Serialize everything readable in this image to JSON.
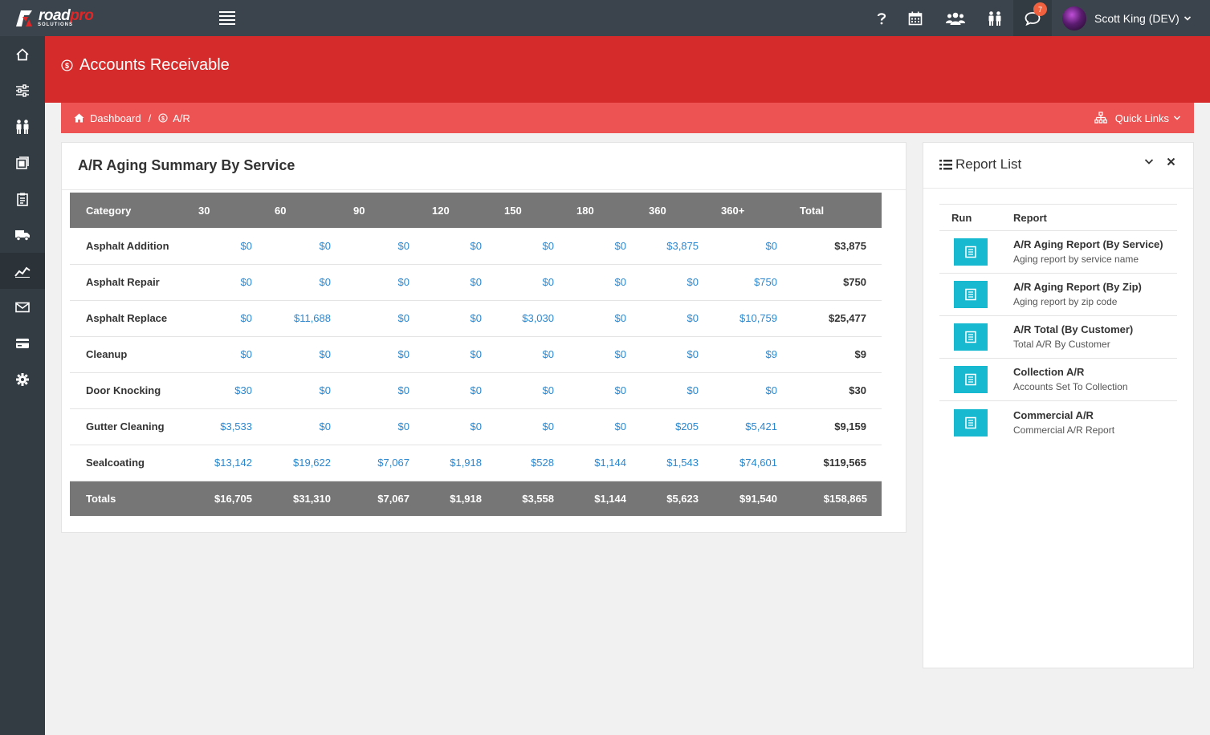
{
  "brand": {
    "part1": "road",
    "part2": "pro",
    "sub": "SOLUTIONS"
  },
  "topbar": {
    "icons": [
      "help-icon",
      "calendar-icon",
      "users-group-icon",
      "people-icon",
      "chat-icon"
    ],
    "chat_badge": "7",
    "user_name": "Scott King (DEV)"
  },
  "sidebar": {
    "items": [
      "home-icon",
      "sliders-icon",
      "people-icon",
      "book-icon",
      "clipboard-icon",
      "truck-icon",
      "chart-line-icon",
      "mail-icon",
      "credit-card-icon",
      "gear-icon"
    ],
    "active": "chart-line-icon"
  },
  "header": {
    "title": "Accounts Receivable",
    "breadcrumb": [
      "Dashboard",
      "A/R"
    ],
    "quick_links": "Quick Links"
  },
  "aging": {
    "title": "A/R Aging Summary By Service",
    "columns": [
      "Category",
      "30",
      "60",
      "90",
      "120",
      "150",
      "180",
      "360",
      "360+",
      "Total"
    ],
    "rows": [
      [
        "Asphalt Addition",
        "$0",
        "$0",
        "$0",
        "$0",
        "$0",
        "$0",
        "$3,875",
        "$0",
        "$3,875"
      ],
      [
        "Asphalt Repair",
        "$0",
        "$0",
        "$0",
        "$0",
        "$0",
        "$0",
        "$0",
        "$750",
        "$750"
      ],
      [
        "Asphalt Replace",
        "$0",
        "$11,688",
        "$0",
        "$0",
        "$3,030",
        "$0",
        "$0",
        "$10,759",
        "$25,477"
      ],
      [
        "Cleanup",
        "$0",
        "$0",
        "$0",
        "$0",
        "$0",
        "$0",
        "$0",
        "$9",
        "$9"
      ],
      [
        "Door Knocking",
        "$30",
        "$0",
        "$0",
        "$0",
        "$0",
        "$0",
        "$0",
        "$0",
        "$30"
      ],
      [
        "Gutter Cleaning",
        "$3,533",
        "$0",
        "$0",
        "$0",
        "$0",
        "$0",
        "$205",
        "$5,421",
        "$9,159"
      ],
      [
        "Sealcoating",
        "$13,142",
        "$19,622",
        "$7,067",
        "$1,918",
        "$528",
        "$1,144",
        "$1,543",
        "$74,601",
        "$119,565"
      ]
    ],
    "totals": [
      "Totals",
      "$16,705",
      "$31,310",
      "$7,067",
      "$1,918",
      "$3,558",
      "$1,144",
      "$5,623",
      "$91,540",
      "$158,865"
    ]
  },
  "report_list": {
    "title": "Report List",
    "col_run": "Run",
    "col_report": "Report",
    "items": [
      {
        "name": "A/R Aging Report (By Service)",
        "desc": "Aging report by service name"
      },
      {
        "name": "A/R Aging Report (By Zip)",
        "desc": "Aging report by zip code"
      },
      {
        "name": "A/R Total (By Customer)",
        "desc": "Total A/R By Customer"
      },
      {
        "name": "Collection A/R",
        "desc": "Accounts Set To Collection"
      },
      {
        "name": "Commercial A/R",
        "desc": "Commercial A/R Report"
      }
    ]
  },
  "colors": {
    "topbar": "#3b444c",
    "sidebar": "#343c43",
    "header_red": "#d52b2b",
    "breadcrumb_red": "#ee5353",
    "link_blue": "#2b87d0",
    "run_button": "#17b9d0",
    "table_header": "#767676"
  }
}
